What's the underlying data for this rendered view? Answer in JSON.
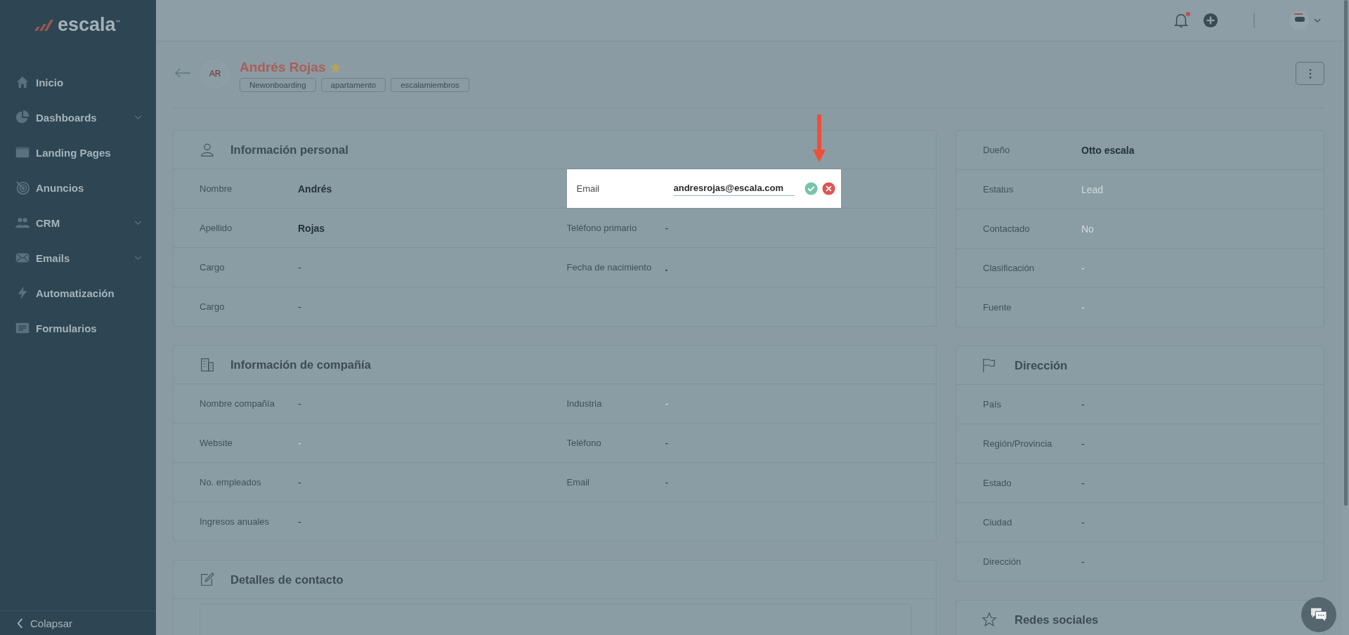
{
  "sidebar": {
    "logo": "escala$^{™}$",
    "items": [
      {
        "label": "Inicio",
        "expandable": false
      },
      {
        "label": "Dashboards",
        "expandable": true
      },
      {
        "label": "Landing Pages",
        "expandable": false
      },
      {
        "label": "Anuncios",
        "expandable": false
      },
      {
        "label": "CRM",
        "expandable": true
      },
      {
        "label": "Emails",
        "expandable": true
      },
      {
        "label": "Automatización",
        "expandable": false
      },
      {
        "label": "Formularios",
        "expandable": false
      }
    ],
    "collapse": "Colapsar"
  },
  "topbar": {
    "unread_notifications": true
  },
  "contact": {
    "initials": "AR",
    "name": "Andrés Rojas",
    "starred": true,
    "tags": [
      "Newonboarding",
      "apartamento",
      "escalamiembros"
    ]
  },
  "left_cards": [
    {
      "title": "Información personal",
      "rows": [
        [
          {
            "label": "Nombre",
            "value": "Andrés",
            "kind": "bold"
          },
          {
            "label": "Email",
            "value": "andresrojas@escala.com",
            "kind": "editing"
          }
        ],
        [
          {
            "label": "Apellido",
            "value": "Rojas",
            "kind": "bold"
          },
          {
            "label": "Teléfono primario",
            "value": "-",
            "kind": "plain"
          }
        ],
        [
          {
            "label": "Cargo",
            "value": "-",
            "kind": "plain"
          },
          {
            "label": "Fecha de nacimiento",
            "value": ".",
            "kind": "bold"
          }
        ],
        [
          {
            "label": "Cargo",
            "value": "-",
            "kind": "plain"
          }
        ]
      ]
    },
    {
      "title": "Información de compañía",
      "rows": [
        [
          {
            "label": "Nombre compañía",
            "value": "-",
            "kind": "plain"
          },
          {
            "label": "Industria",
            "value": "-",
            "kind": "muted"
          }
        ],
        [
          {
            "label": "Website",
            "value": "-",
            "kind": "muted"
          },
          {
            "label": "Teléfono",
            "value": "-",
            "kind": "plain"
          }
        ],
        [
          {
            "label": "No. empleados",
            "value": "-",
            "kind": "plain"
          },
          {
            "label": "Email",
            "value": "-",
            "kind": "plain"
          }
        ],
        [
          {
            "label": "Ingresos anuales",
            "value": "-",
            "kind": "plain"
          }
        ]
      ]
    },
    {
      "title": "Detalles de contacto"
    }
  ],
  "right_cards": [
    {
      "rows": [
        [
          {
            "label": "Dueño",
            "value": "Otto escala",
            "kind": "bold"
          }
        ],
        [
          {
            "label": "Estatus",
            "value": "Lead",
            "kind": "muted"
          }
        ],
        [
          {
            "label": "Contactado",
            "value": "No",
            "kind": "muted"
          }
        ],
        [
          {
            "label": "Clasificación",
            "value": "-",
            "kind": "muted"
          }
        ],
        [
          {
            "label": "Fuente",
            "value": "-",
            "kind": "muted"
          }
        ]
      ]
    },
    {
      "title": "Dirección",
      "rows": [
        [
          {
            "label": "País",
            "value": "-",
            "kind": "plain"
          }
        ],
        [
          {
            "label": "Región/Provincia",
            "value": "-",
            "kind": "plain"
          }
        ],
        [
          {
            "label": "Estado",
            "value": "-",
            "kind": "plain"
          }
        ],
        [
          {
            "label": "Ciudad",
            "value": "-",
            "kind": "plain"
          }
        ],
        [
          {
            "label": "Dirección",
            "value": "-",
            "kind": "plain"
          }
        ]
      ]
    },
    {
      "title": "Redes sociales"
    }
  ]
}
